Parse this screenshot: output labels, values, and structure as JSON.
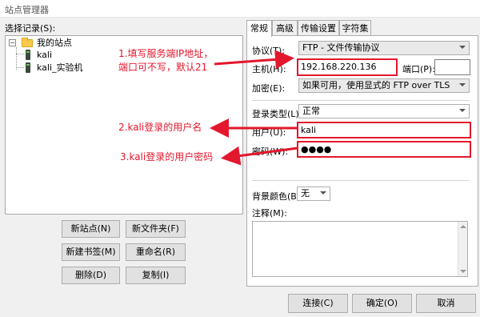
{
  "window": {
    "title": "站点管理器"
  },
  "left": {
    "select_entry_label": "选择记录(S):",
    "tree": {
      "root": {
        "expander": "−",
        "label": "我的站点"
      },
      "children": [
        {
          "label": "kali"
        },
        {
          "label": "kali_实验机"
        }
      ]
    },
    "buttons": {
      "new_site": "新站点(N)",
      "new_folder": "新文件夹(F)",
      "new_bookmark": "新建书签(M)",
      "rename": "重命名(R)",
      "delete": "删除(D)",
      "copy": "复制(I)"
    }
  },
  "tabs": [
    "常规",
    "高级",
    "传输设置",
    "字符集"
  ],
  "general": {
    "protocol_label": "协议(T):",
    "protocol_value": "FTP - 文件传输协议",
    "host_label": "主机(H):",
    "host_value": "192.168.220.136",
    "port_label": "端口(P):",
    "port_value": "",
    "encryption_label": "加密(E):",
    "encryption_value": "如果可用，使用显式的 FTP over TLS",
    "logon_type_label": "登录类型(L):",
    "logon_type_value": "正常",
    "user_label": "用户(U):",
    "user_value": "kali",
    "password_label": "密码(W):",
    "password_value": "●●●●",
    "bg_color_label": "背景颜色(B)",
    "bg_color_value": "无",
    "comments_label": "注释(M):"
  },
  "annotations": {
    "host_note_line1": "1.填写服务端IP地址，",
    "host_note_line2": "端口可不写，默认21",
    "user_note": "2.kali登录的用户名",
    "password_note": "3.kali登录的用户密码",
    "color": "#e3172d"
  },
  "footer": {
    "connect": "连接(C)",
    "ok": "确定(O)",
    "cancel": "取消"
  }
}
